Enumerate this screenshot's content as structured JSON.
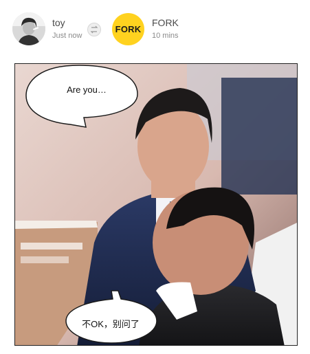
{
  "post": {
    "user": {
      "name": "toy",
      "time": "Just now"
    },
    "original": {
      "name": "FORK",
      "time": "10 mins",
      "logo_text": "FORK",
      "logo_color": "#ffd21f"
    },
    "swap_icon": "swap-icon"
  },
  "meme": {
    "bubble_top": "Are you…",
    "bubble_bottom": "不OK，别问了"
  }
}
